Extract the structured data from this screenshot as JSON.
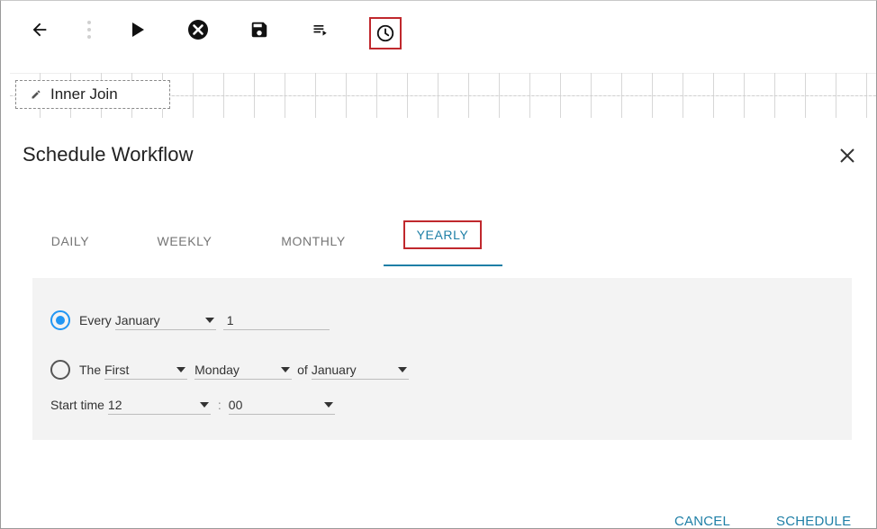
{
  "toolbar": {
    "icons": [
      "back-arrow-icon",
      "more-vert-icon",
      "play-icon",
      "cancel-circle-icon",
      "save-icon",
      "playlist-icon",
      "clock-icon"
    ]
  },
  "canvas": {
    "node_label": "Inner Join"
  },
  "dialog": {
    "title": "Schedule Workflow",
    "tabs": [
      {
        "label": "DAILY"
      },
      {
        "label": "WEEKLY"
      },
      {
        "label": "MONTHLY"
      },
      {
        "label": "YEARLY",
        "active": true
      }
    ],
    "every": {
      "label": "Every",
      "month": "January",
      "day": "1",
      "selected": true
    },
    "the": {
      "label": "The",
      "ordinal": "First",
      "weekday": "Monday",
      "of_label": "of",
      "month": "January",
      "selected": false
    },
    "start_time": {
      "label": "Start time",
      "hour": "12",
      "separator": ":",
      "minute": "00"
    },
    "cancel_label": "CANCEL",
    "schedule_label": "SCHEDULE"
  },
  "colors": {
    "accent": "#1e7fa6",
    "radio_active": "#2196f3",
    "highlight_box": "#c0282d",
    "panel_bg": "#f3f3f3"
  }
}
